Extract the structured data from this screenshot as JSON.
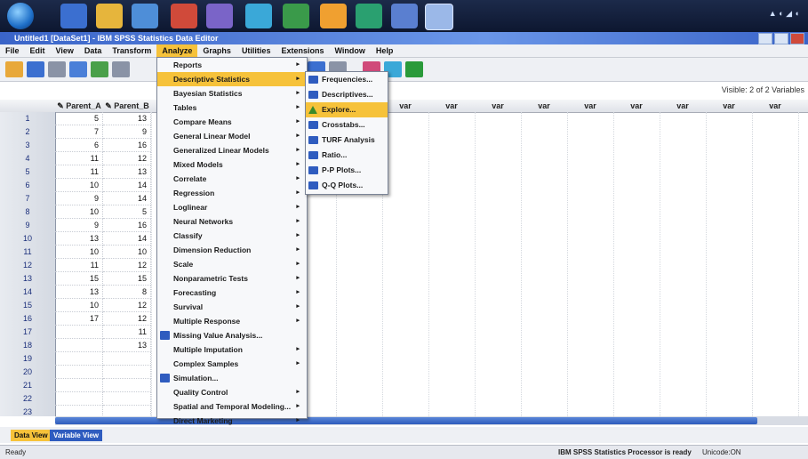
{
  "window": {
    "title": "Untitled1 [DataSet1] - IBM SPSS Statistics Data Editor"
  },
  "menubar": [
    "File",
    "Edit",
    "View",
    "Data",
    "Transform",
    "Analyze",
    "Graphs",
    "Utilities",
    "Extensions",
    "Window",
    "Help"
  ],
  "menubar_active": "Analyze",
  "visible_vars": "Visible: 2 of 2 Variables",
  "columns": [
    "Parent_A",
    "Parent_B"
  ],
  "rows": [
    {
      "n": "1",
      "a": "5",
      "b": "13"
    },
    {
      "n": "2",
      "a": "7",
      "b": "9"
    },
    {
      "n": "3",
      "a": "6",
      "b": "16"
    },
    {
      "n": "4",
      "a": "11",
      "b": "12"
    },
    {
      "n": "5",
      "a": "11",
      "b": "13"
    },
    {
      "n": "6",
      "a": "10",
      "b": "14"
    },
    {
      "n": "7",
      "a": "9",
      "b": "14"
    },
    {
      "n": "8",
      "a": "10",
      "b": "5"
    },
    {
      "n": "9",
      "a": "9",
      "b": "16"
    },
    {
      "n": "10",
      "a": "13",
      "b": "14"
    },
    {
      "n": "11",
      "a": "10",
      "b": "10"
    },
    {
      "n": "12",
      "a": "11",
      "b": "12"
    },
    {
      "n": "13",
      "a": "15",
      "b": "15"
    },
    {
      "n": "14",
      "a": "13",
      "b": "8"
    },
    {
      "n": "15",
      "a": "10",
      "b": "12"
    },
    {
      "n": "16",
      "a": "17",
      "b": "12"
    },
    {
      "n": "17",
      "a": "",
      "b": "11"
    },
    {
      "n": "18",
      "a": "",
      "b": "13"
    },
    {
      "n": "19",
      "a": "",
      "b": ""
    },
    {
      "n": "20",
      "a": "",
      "b": ""
    },
    {
      "n": "21",
      "a": "",
      "b": ""
    },
    {
      "n": "22",
      "a": "",
      "b": ""
    },
    {
      "n": "23",
      "a": "",
      "b": ""
    }
  ],
  "analyze_menu": [
    {
      "label": "Reports",
      "arrow": true
    },
    {
      "label": "Descriptive Statistics",
      "arrow": true,
      "highlight": true
    },
    {
      "label": "Bayesian Statistics",
      "arrow": true
    },
    {
      "label": "Tables",
      "arrow": true
    },
    {
      "label": "Compare Means",
      "arrow": true
    },
    {
      "label": "General Linear Model",
      "arrow": true
    },
    {
      "label": "Generalized Linear Models",
      "arrow": true
    },
    {
      "label": "Mixed Models",
      "arrow": true
    },
    {
      "label": "Correlate",
      "arrow": true
    },
    {
      "label": "Regression",
      "arrow": true
    },
    {
      "label": "Loglinear",
      "arrow": true
    },
    {
      "label": "Neural Networks",
      "arrow": true
    },
    {
      "label": "Classify",
      "arrow": true
    },
    {
      "label": "Dimension Reduction",
      "arrow": true
    },
    {
      "label": "Scale",
      "arrow": true
    },
    {
      "label": "Nonparametric Tests",
      "arrow": true
    },
    {
      "label": "Forecasting",
      "arrow": true
    },
    {
      "label": "Survival",
      "arrow": true
    },
    {
      "label": "Multiple Response",
      "arrow": true
    },
    {
      "label": "Missing Value Analysis...",
      "icon": true
    },
    {
      "label": "Multiple Imputation",
      "arrow": true
    },
    {
      "label": "Complex Samples",
      "arrow": true
    },
    {
      "label": "Simulation...",
      "icon": true
    },
    {
      "label": "Quality Control",
      "arrow": true
    },
    {
      "label": "Spatial and Temporal Modeling...",
      "arrow": true
    },
    {
      "label": "Direct Marketing",
      "arrow": true
    }
  ],
  "descriptive_menu": [
    {
      "label": "Frequencies..."
    },
    {
      "label": "Descriptives..."
    },
    {
      "label": "Explore...",
      "highlight": true,
      "icon": "tri"
    },
    {
      "label": "Crosstabs..."
    },
    {
      "label": "TURF Analysis"
    },
    {
      "label": "Ratio..."
    },
    {
      "label": "P-P Plots..."
    },
    {
      "label": "Q-Q Plots..."
    }
  ],
  "tabs": {
    "data": "Data View",
    "variable": "Variable View"
  },
  "status": {
    "left": "Ready",
    "processor": "IBM SPSS Statistics Processor is ready",
    "unicode": "Unicode:ON"
  }
}
